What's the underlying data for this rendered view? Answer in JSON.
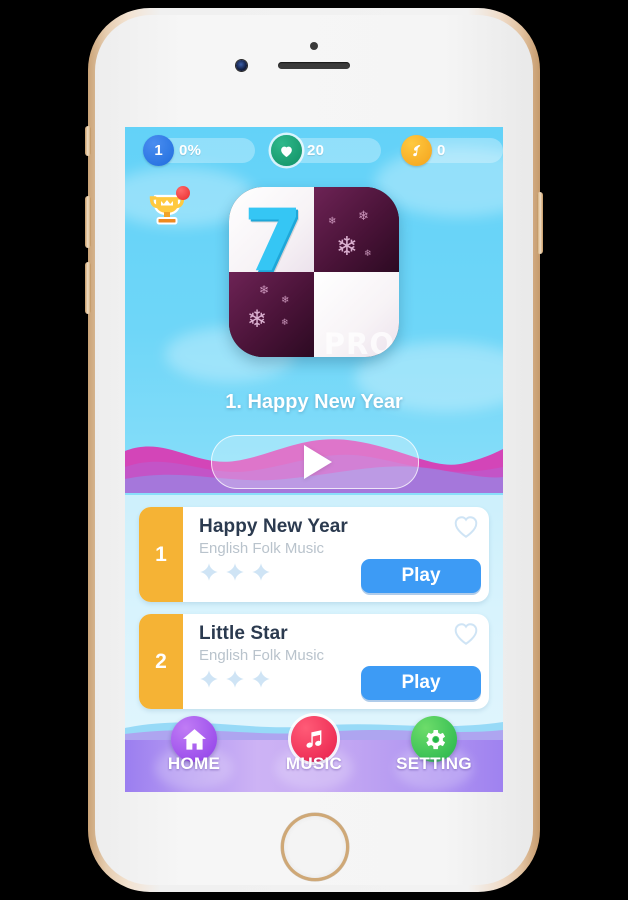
{
  "device": {
    "name": "smartphone-mockup",
    "camera": "front-camera",
    "speaker": "earpiece-speaker",
    "sensor": "proximity-sensor",
    "home_button": "home-button",
    "side_buttons": [
      "silent-switch",
      "volume-up",
      "volume-down",
      "power-button"
    ]
  },
  "status_bar": {
    "level": {
      "icon": "level-badge",
      "badge": "1",
      "value": "0%"
    },
    "lives": {
      "icon": "heart-icon",
      "value": "20"
    },
    "coins": {
      "icon": "music-note-icon",
      "value": "0"
    }
  },
  "trophy": {
    "icon": "trophy-icon",
    "badge": "new-notification-dot"
  },
  "app_icon": {
    "name": "piano-tiles-app-icon",
    "number": "7",
    "label": "PRO",
    "snowflake": "❄"
  },
  "now_playing": {
    "title": "1. Happy New Year",
    "play_button": "play-triangle-icon"
  },
  "song_list": [
    {
      "num": "1",
      "title": "Happy New Year",
      "artist": "English Folk Music",
      "stars": 3,
      "stars_filled": 0,
      "play_label": "Play",
      "favorite": false
    },
    {
      "num": "2",
      "title": "Little Star",
      "artist": "English Folk Music",
      "stars": 3,
      "stars_filled": 0,
      "play_label": "Play",
      "favorite": false
    }
  ],
  "bottom_nav": [
    {
      "label": "HOME",
      "icon": "house-icon",
      "active": true
    },
    {
      "label": "MUSIC",
      "icon": "music-note-icon",
      "active": false
    },
    {
      "label": "SETTING",
      "icon": "gear-icon",
      "active": false
    }
  ],
  "colors": {
    "sky": "#63d2f8",
    "wave_magenta": "#d345b8",
    "wave_purple": "#9d7fe0",
    "row_number_orange": "#f5b335",
    "play_blue": "#3d9bf5",
    "title_navy": "#2b3a4f",
    "artist_gray": "#b9c3cc",
    "star_pale": "#cfe4f5",
    "nav_home_purple": "#8f3fe8",
    "nav_music_red": "#e81e4a",
    "nav_setting_green": "#23b44b",
    "badge_red": "#e82c2c",
    "heart_green": "#119064",
    "coin_orange": "#f3a21d"
  }
}
